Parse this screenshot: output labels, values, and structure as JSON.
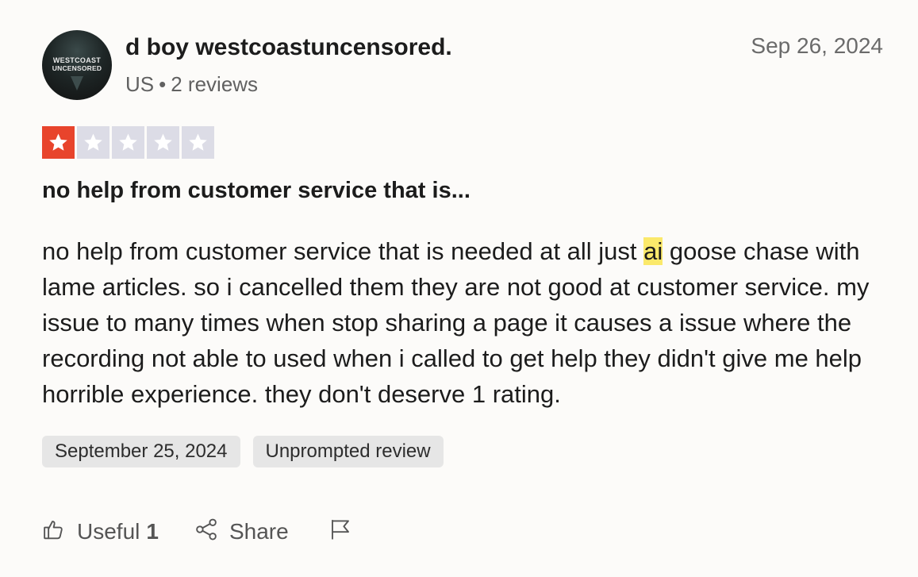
{
  "reviewer": {
    "avatar_text_line1": "WESTCOAST",
    "avatar_text_line2": "UNCENSORED",
    "name": "d boy westcoastuncensored.",
    "country": "US",
    "separator": "•",
    "review_count": "2 reviews"
  },
  "review": {
    "date": "Sep 26, 2024",
    "rating": 1,
    "rating_max": 5,
    "star_filled_color": "#e8442c",
    "star_empty_color": "#dcdce6",
    "title": "no help from customer service that is...",
    "body_before": "no help from customer service that is needed at all just ",
    "body_highlight": "ai",
    "body_after": " goose chase with lame articles. so i cancelled them they are not good at customer service. my issue to many times when stop sharing a page it causes a issue where the recording not able to used when i called to get help they didn't give me help horrible experience. they don't deserve 1 rating.",
    "highlight_color": "#fbe96b"
  },
  "tags": {
    "experience_date": "September 25, 2024",
    "review_type": "Unprompted review"
  },
  "actions": {
    "useful_label": "Useful",
    "useful_count": "1",
    "share_label": "Share",
    "icons": [
      "thumbs-up-icon",
      "share-icon",
      "flag-icon"
    ]
  }
}
